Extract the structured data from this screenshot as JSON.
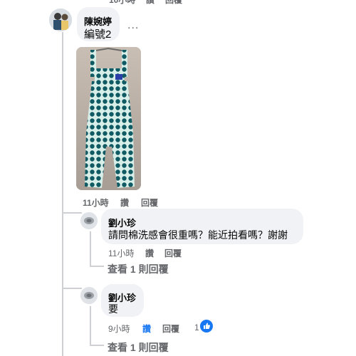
{
  "top_partial": {
    "time": "10小時",
    "like": "讚",
    "reply": "回覆"
  },
  "comment_main": {
    "author": "陳婉婷",
    "text": "編號2",
    "more": "...",
    "time": "11小時",
    "like": "讚",
    "reply": "回覆"
  },
  "reply_1": {
    "author": "劉小珍",
    "text": "請問棉洗感會很重嗎？能近拍看嗎？謝謝",
    "time": "11小時",
    "like": "讚",
    "reply": "回覆",
    "view_replies": "查看 1 則回覆"
  },
  "reply_2": {
    "author": "劉小珍",
    "text": "要",
    "time": "9小時",
    "like": "讚",
    "reply": "回覆",
    "reaction_count": "1",
    "view_replies": "查看 1 則回覆"
  },
  "colors": {
    "bubble": "#f0f2f5",
    "like_blue": "#1877f2",
    "meta": "#65676b"
  }
}
